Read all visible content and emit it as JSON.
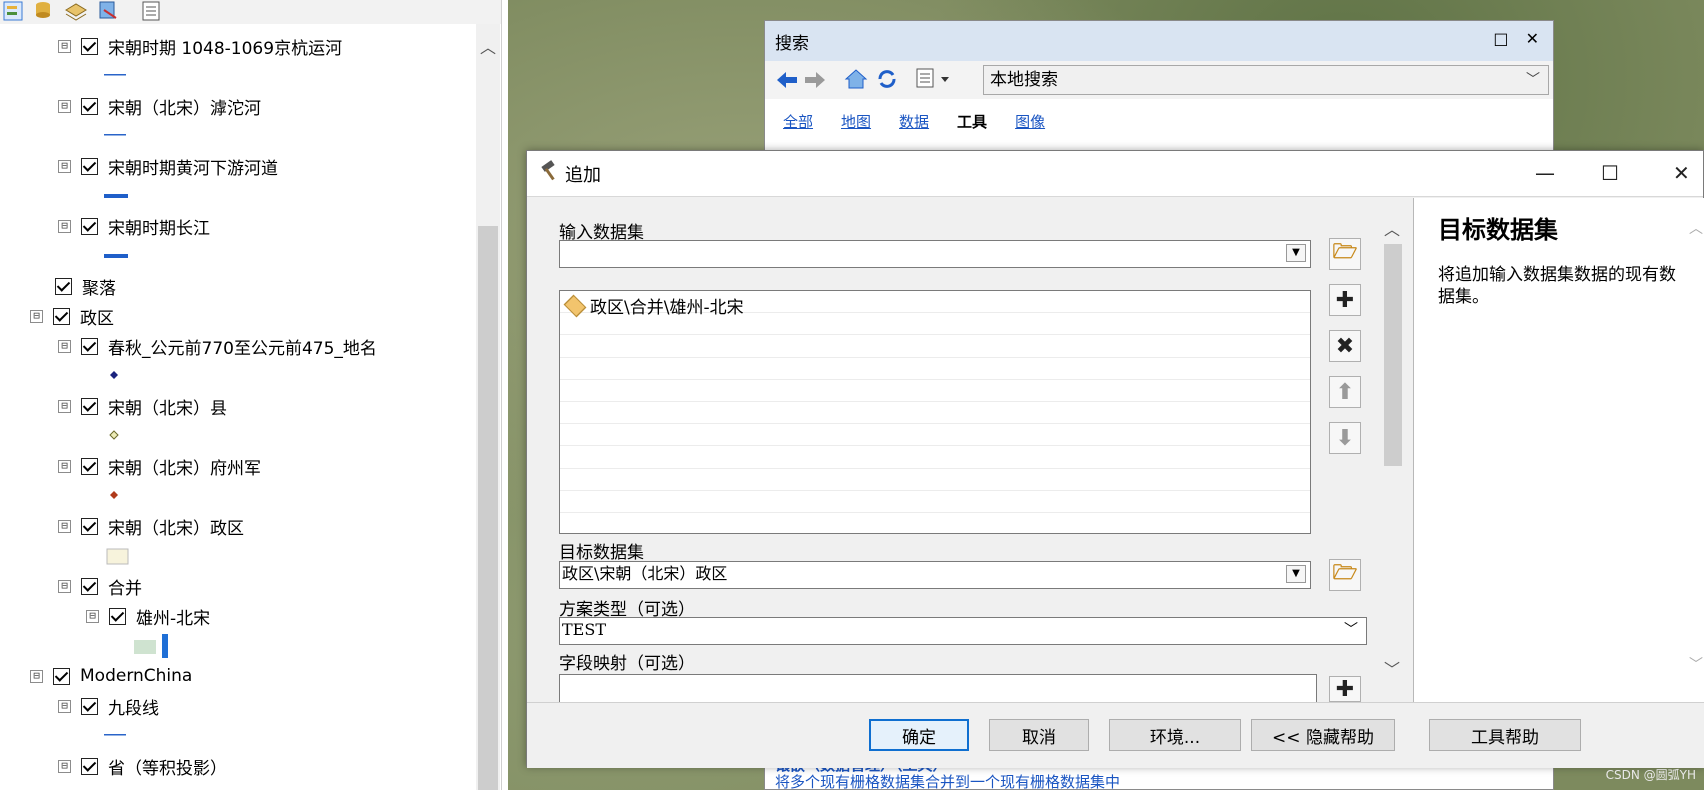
{
  "toc": {
    "items": [
      {
        "label": "宋朝时期 1048-1069京杭运河"
      },
      {
        "label": "宋朝（北宋）滹沱河"
      },
      {
        "label": "宋朝时期黄河下游河道"
      },
      {
        "label": "宋朝时期长江"
      },
      {
        "label": "聚落"
      },
      {
        "label": "政区"
      },
      {
        "label": "春秋_公元前770至公元前475_地名"
      },
      {
        "label": "宋朝（北宋）县"
      },
      {
        "label": "宋朝（北宋）府州军"
      },
      {
        "label": "宋朝（北宋）政区"
      },
      {
        "label": "合并"
      },
      {
        "label": "雄州-北宋"
      },
      {
        "label": "ModernChina"
      },
      {
        "label": "九段线"
      },
      {
        "label": "省（等积投影）"
      }
    ],
    "expander_symbol": "⊟",
    "colors": {
      "line": "#2a64c9",
      "point_dark": "#1a237e",
      "point_light": "#d8d49a",
      "point_red": "#b03a1a",
      "poly_fill": "#f7f3dc",
      "merge_fill": "#cfe3d0",
      "merge_bar": "#1f6fd6"
    }
  },
  "search": {
    "title": "搜索",
    "window_controls": "□ ✕",
    "scope": "本地搜索",
    "tabs": [
      "全部",
      "地图",
      "数据",
      "工具",
      "图像"
    ],
    "active_tab": "工具",
    "result_title": "镶嵌（数据管理）（工具）",
    "result_desc": "将多个现有栅格数据集合并到一个现有栅格数据集中"
  },
  "dialog": {
    "title": "追加",
    "input_label": "输入数据集",
    "input_value": "",
    "list_items": [
      "政区\\合并\\雄州-北宋"
    ],
    "target_label": "目标数据集",
    "target_value": "政区\\宋朝（北宋）政区",
    "schema_label": "方案类型（可选）",
    "schema_value": "TEST",
    "field_map_label": "字段映射（可选）",
    "help_title": "目标数据集",
    "help_text": "将追加输入数据集数据的现有数据集。",
    "buttons": {
      "ok": "确定",
      "cancel": "取消",
      "env": "环境...",
      "hide_help": "<< 隐藏帮助",
      "tool_help": "工具帮助"
    },
    "side_icons": [
      "add-icon",
      "remove-icon",
      "move-up-icon",
      "move-down-icon"
    ]
  },
  "watermark": "CSDN @圆弧YH"
}
